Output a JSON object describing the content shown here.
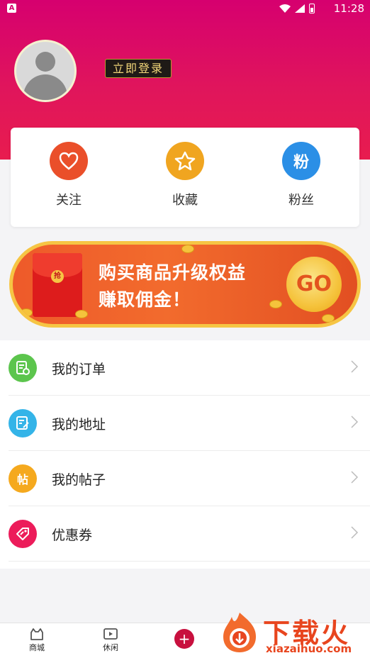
{
  "status_bar": {
    "notification_icon": "a-icon",
    "time": "11:28"
  },
  "profile": {
    "avatar_icon": "default-avatar",
    "login_label": "立即登录"
  },
  "stats": [
    {
      "label": "关注",
      "icon": "heart-icon",
      "color": "#ea4f2a"
    },
    {
      "label": "收藏",
      "icon": "star-icon",
      "color": "#f0a520"
    },
    {
      "label": "粉丝",
      "icon_text": "粉",
      "color": "#2b8fe6"
    }
  ],
  "banner": {
    "packet_seal": "抢",
    "line1": "购买商品升级权益",
    "line2": "赚取佣金！",
    "go_label": "GO"
  },
  "menu": [
    {
      "label": "我的订单",
      "icon": "order-icon",
      "color": "#5cc54d"
    },
    {
      "label": "我的地址",
      "icon": "edit-note-icon",
      "color": "#34b4e8"
    },
    {
      "label": "我的帖子",
      "icon_text": "帖",
      "color": "#f5a91e"
    },
    {
      "label": "优惠券",
      "icon": "coupon-tag-icon",
      "color": "#ec1c5a"
    }
  ],
  "tabbar": [
    {
      "label": "商城",
      "icon": "mall-cat-icon"
    },
    {
      "label": "休闲",
      "icon": "video-icon"
    },
    {
      "label": "",
      "icon": "plus-icon"
    }
  ],
  "watermark": {
    "title": "下载火",
    "url": "xiazaihuo.com"
  },
  "colors": {
    "header_pink": "#d6006f",
    "accent_red": "#e81c4f",
    "banner_orange": "#ee5a2a",
    "gold": "#f6c544"
  }
}
